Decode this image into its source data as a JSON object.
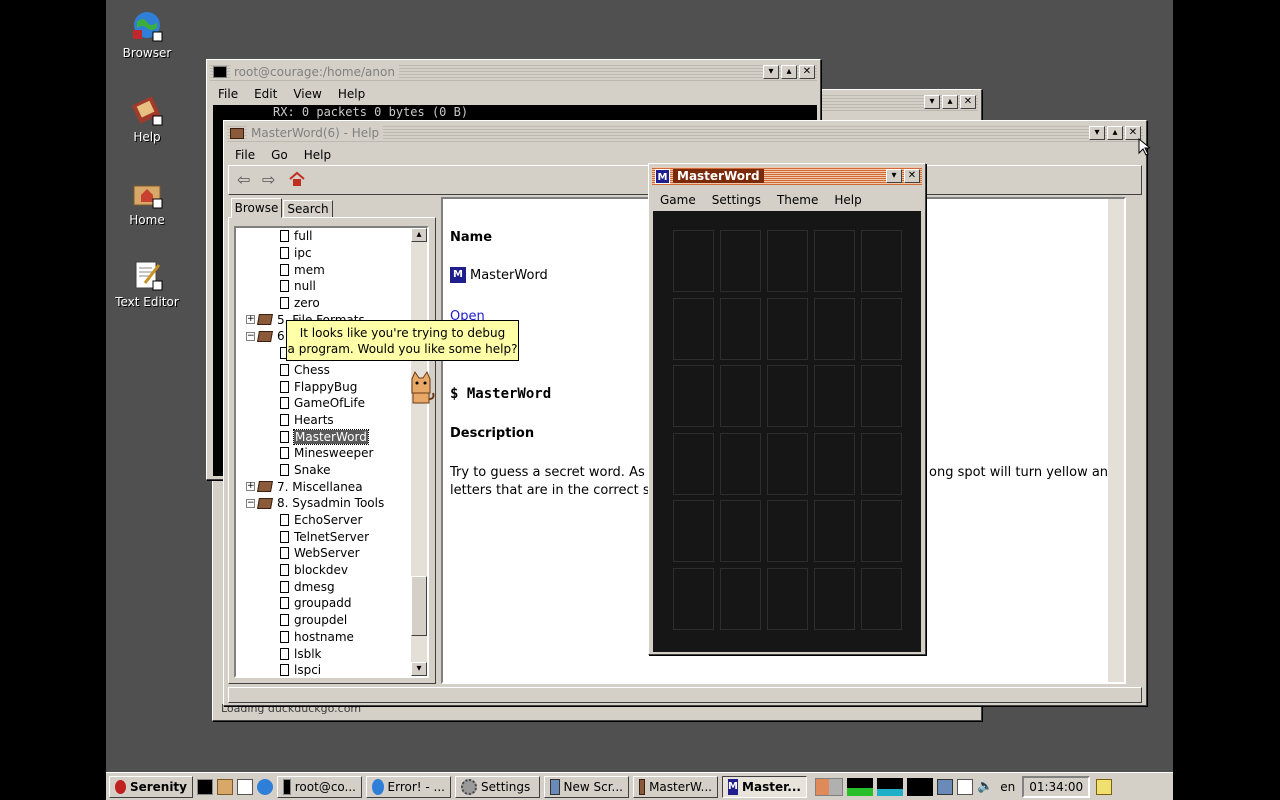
{
  "desktop": {
    "icons": [
      {
        "label": "Browser",
        "icon": "globe-icon"
      },
      {
        "label": "Help",
        "icon": "help-book-icon"
      },
      {
        "label": "Home",
        "icon": "home-folder-icon"
      },
      {
        "label": "Text Editor",
        "icon": "text-editor-icon"
      }
    ]
  },
  "terminal": {
    "title": "root@courage:/home/anon",
    "menu": [
      "File",
      "Edit",
      "View",
      "Help"
    ],
    "line1": "RX: 0 packets 0 bytes (0 B)"
  },
  "browser_window": {
    "status": "Loading duckduckgo.com"
  },
  "help": {
    "title": "MasterWord(6) - Help",
    "menu": [
      "File",
      "Go",
      "Help"
    ],
    "tabs": [
      "Browse",
      "Search"
    ],
    "tree": [
      {
        "label": "full",
        "type": "file",
        "level": 2
      },
      {
        "label": "ipc",
        "type": "file",
        "level": 2
      },
      {
        "label": "mem",
        "type": "file",
        "level": 2
      },
      {
        "label": "null",
        "type": "file",
        "level": 2
      },
      {
        "label": "zero",
        "type": "file",
        "level": 2
      },
      {
        "label": "5. File Formats",
        "type": "book",
        "level": 1,
        "expander": "+"
      },
      {
        "label": "6",
        "type": "book",
        "level": 1,
        "expander": "-"
      },
      {
        "label": "",
        "type": "file",
        "level": 2
      },
      {
        "label": "Chess",
        "type": "file",
        "level": 2
      },
      {
        "label": "FlappyBug",
        "type": "file",
        "level": 2
      },
      {
        "label": "GameOfLife",
        "type": "file",
        "level": 2
      },
      {
        "label": "Hearts",
        "type": "file",
        "level": 2
      },
      {
        "label": "MasterWord",
        "type": "file",
        "level": 2,
        "selected": true
      },
      {
        "label": "Minesweeper",
        "type": "file",
        "level": 2
      },
      {
        "label": "Snake",
        "type": "file",
        "level": 2
      },
      {
        "label": "7. Miscellanea",
        "type": "book",
        "level": 1,
        "expander": "+"
      },
      {
        "label": "8. Sysadmin Tools",
        "type": "book",
        "level": 1,
        "expander": "-"
      },
      {
        "label": "EchoServer",
        "type": "file",
        "level": 2
      },
      {
        "label": "TelnetServer",
        "type": "file",
        "level": 2
      },
      {
        "label": "WebServer",
        "type": "file",
        "level": 2
      },
      {
        "label": "blockdev",
        "type": "file",
        "level": 2
      },
      {
        "label": "dmesg",
        "type": "file",
        "level": 2
      },
      {
        "label": "groupadd",
        "type": "file",
        "level": 2
      },
      {
        "label": "groupdel",
        "type": "file",
        "level": 2
      },
      {
        "label": "hostname",
        "type": "file",
        "level": 2
      },
      {
        "label": "lsblk",
        "type": "file",
        "level": 2
      },
      {
        "label": "lspci",
        "type": "file",
        "level": 2
      }
    ],
    "content": {
      "name_heading": "Name",
      "app_name": "MasterWord",
      "open_link": "Open",
      "command": "$ MasterWord",
      "desc_heading": "Description",
      "desc_left": "Try to guess a secret word. As y",
      "desc_left2": "letters that are in the correct sp",
      "desc_right": "ong spot will turn yellow and"
    }
  },
  "assistant": {
    "bubble_line1": "It looks like you're trying to debug",
    "bubble_line2": "a program. Would you like some help?"
  },
  "masterword": {
    "title": "MasterWord",
    "menu": [
      "Game",
      "Settings",
      "Theme",
      "Help"
    ],
    "rows": 6,
    "cols": 5
  },
  "taskbar": {
    "start": "Serenity",
    "buttons": [
      {
        "label": "root@co...",
        "icon": "terminal-icon"
      },
      {
        "label": "Error! - ...",
        "icon": "browser-icon"
      },
      {
        "label": "Settings",
        "icon": "settings-icon"
      },
      {
        "label": "New Scr...",
        "icon": "screenshot-icon"
      },
      {
        "label": "MasterW...",
        "icon": "help-icon"
      },
      {
        "label": "Master...",
        "icon": "masterword-icon",
        "pressed": true
      }
    ],
    "keymap": "en",
    "clock": "01:34:00"
  },
  "colors": {
    "desktop": "#505050",
    "window": "#d4d0c8",
    "active_title": "#d06a38",
    "link": "#1c1cd0",
    "game_bg": "#161616"
  }
}
